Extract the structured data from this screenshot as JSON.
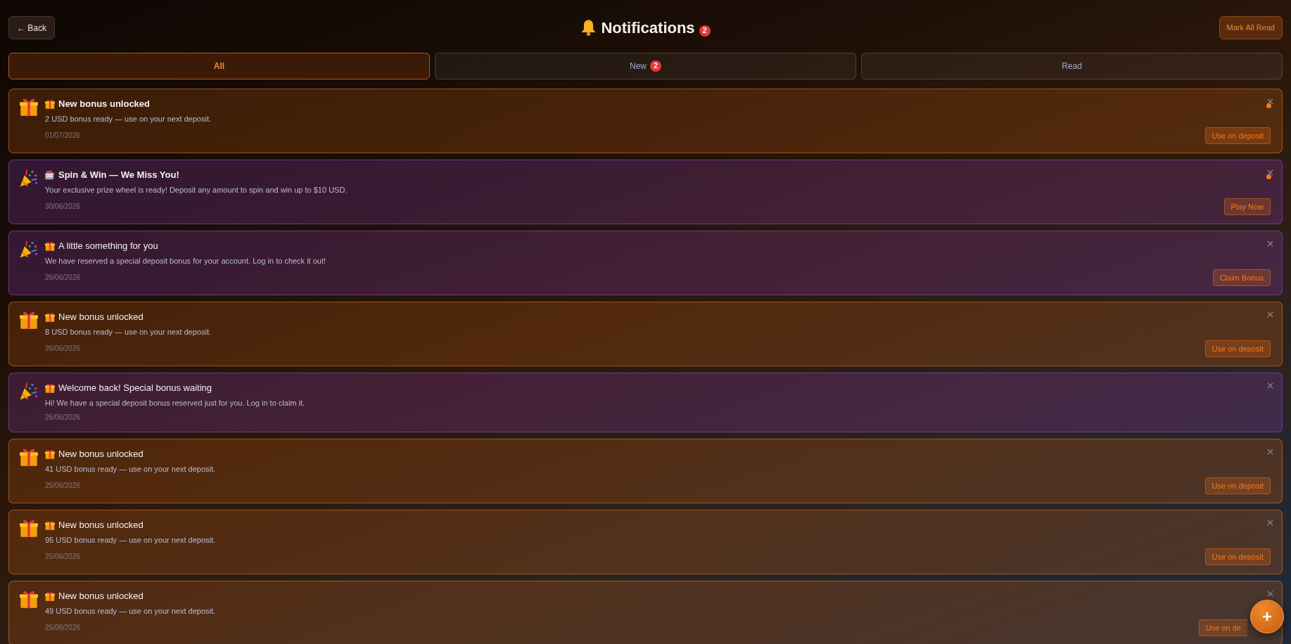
{
  "header": {
    "back_button": "← Back",
    "title": "Notifications",
    "unread_count": "2",
    "mark_all_read_button": "Mark All Read"
  },
  "tabs": [
    {
      "label": "All",
      "selected": true
    },
    {
      "label": "New",
      "selected": false,
      "badge": "2"
    },
    {
      "label": "Read",
      "selected": false
    }
  ],
  "notifications": [
    {
      "kind": "bonus",
      "title": "New bonus unlocked",
      "message": "2 USD bonus ready — use on your next deposit.",
      "date": "01/07/2026",
      "unread": true,
      "action": "Use on deposit"
    },
    {
      "kind": "spin",
      "title": "Spin & Win — We Miss You!",
      "message": "Your exclusive prize wheel is ready! Deposit any amount to spin and win up to $10 USD.",
      "date": "30/06/2026",
      "unread": true,
      "action": "Play Now"
    },
    {
      "kind": "promo",
      "title": "A little something for you",
      "message": "We have reserved a special deposit bonus for your account. Log in to check it out!",
      "date": "26/06/2026",
      "unread": false,
      "action": "Claim Bonus"
    },
    {
      "kind": "bonus",
      "title": "New bonus unlocked",
      "message": "8 USD bonus ready — use on your next deposit.",
      "date": "26/06/2026",
      "unread": false,
      "action": "Use on deposit"
    },
    {
      "kind": "promo",
      "title": "Welcome back! Special bonus waiting",
      "message": "Hi! We have a special deposit bonus reserved just for you. Log in to claim it.",
      "date": "26/06/2026",
      "unread": false
    },
    {
      "kind": "bonus",
      "title": "New bonus unlocked",
      "message": "41 USD bonus ready — use on your next deposit.",
      "date": "25/06/2026",
      "unread": false,
      "action": "Use on deposit"
    },
    {
      "kind": "bonus",
      "title": "New bonus unlocked",
      "message": "95 USD bonus ready — use on your next deposit.",
      "date": "25/06/2026",
      "unread": false,
      "action": "Use on deposit"
    },
    {
      "kind": "bonus",
      "title": "New bonus unlocked",
      "message": "49 USD bonus ready — use on your next deposit.",
      "date": "25/06/2026",
      "unread": false,
      "action": "Use on de"
    }
  ]
}
